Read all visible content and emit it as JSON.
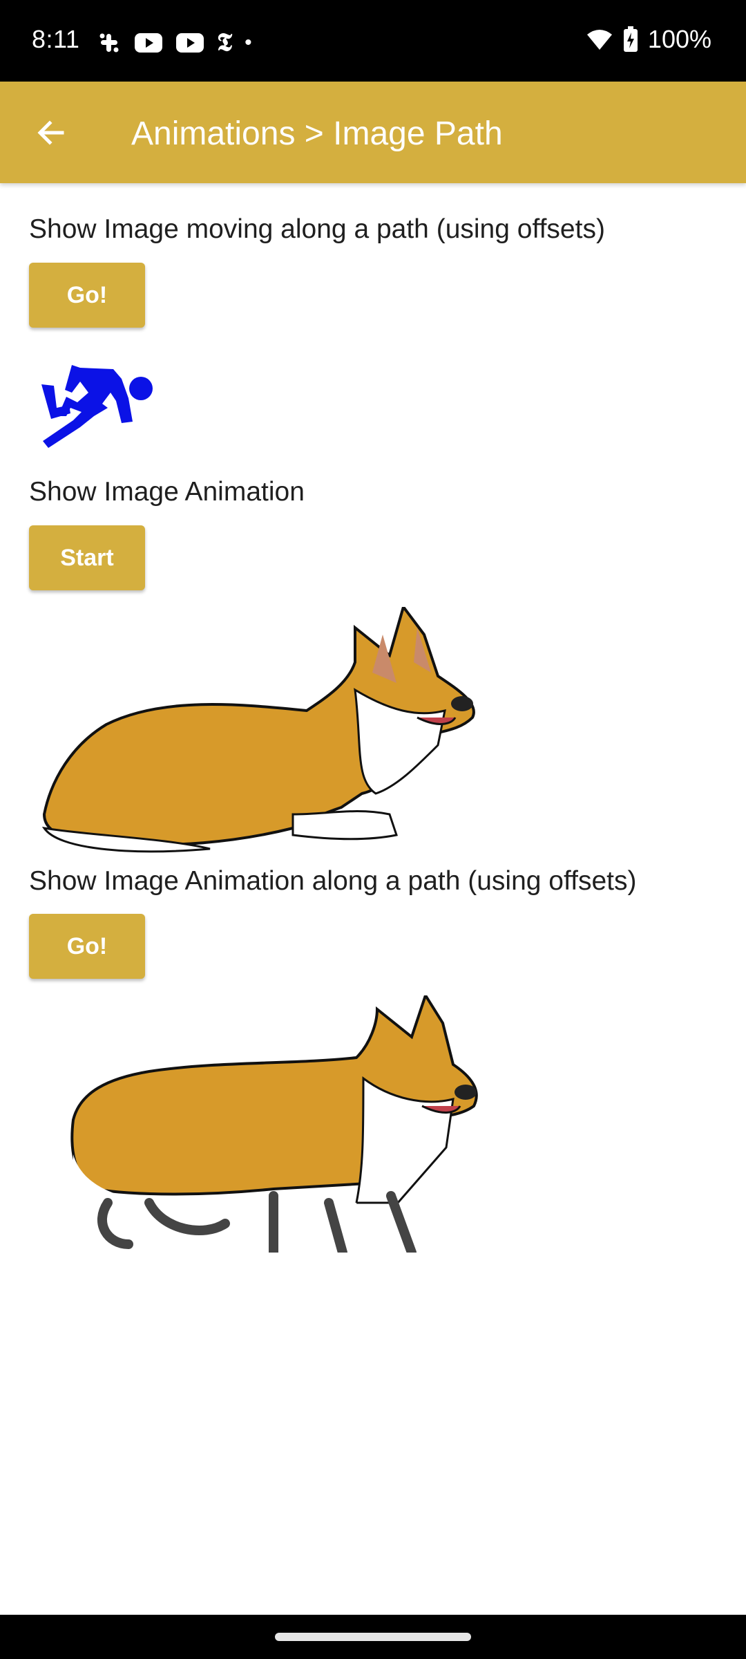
{
  "status_bar": {
    "time": "8:11",
    "battery": "100%",
    "icons": [
      "slack-icon",
      "youtube-icon",
      "youtube-icon",
      "nytimes-icon",
      "dot-icon",
      "wifi-icon",
      "battery-charging-icon"
    ]
  },
  "app_bar": {
    "title": "Animations > Image Path",
    "back_icon": "arrow-left-icon",
    "color": "#D4AF3F"
  },
  "sections": [
    {
      "label": "Show Image moving along a path (using offsets)",
      "button": "Go!"
    },
    {
      "label": "Show Image Animation",
      "button": "Start"
    },
    {
      "label": "Show Image Animation along a path (using offsets)",
      "button": "Go!"
    }
  ]
}
